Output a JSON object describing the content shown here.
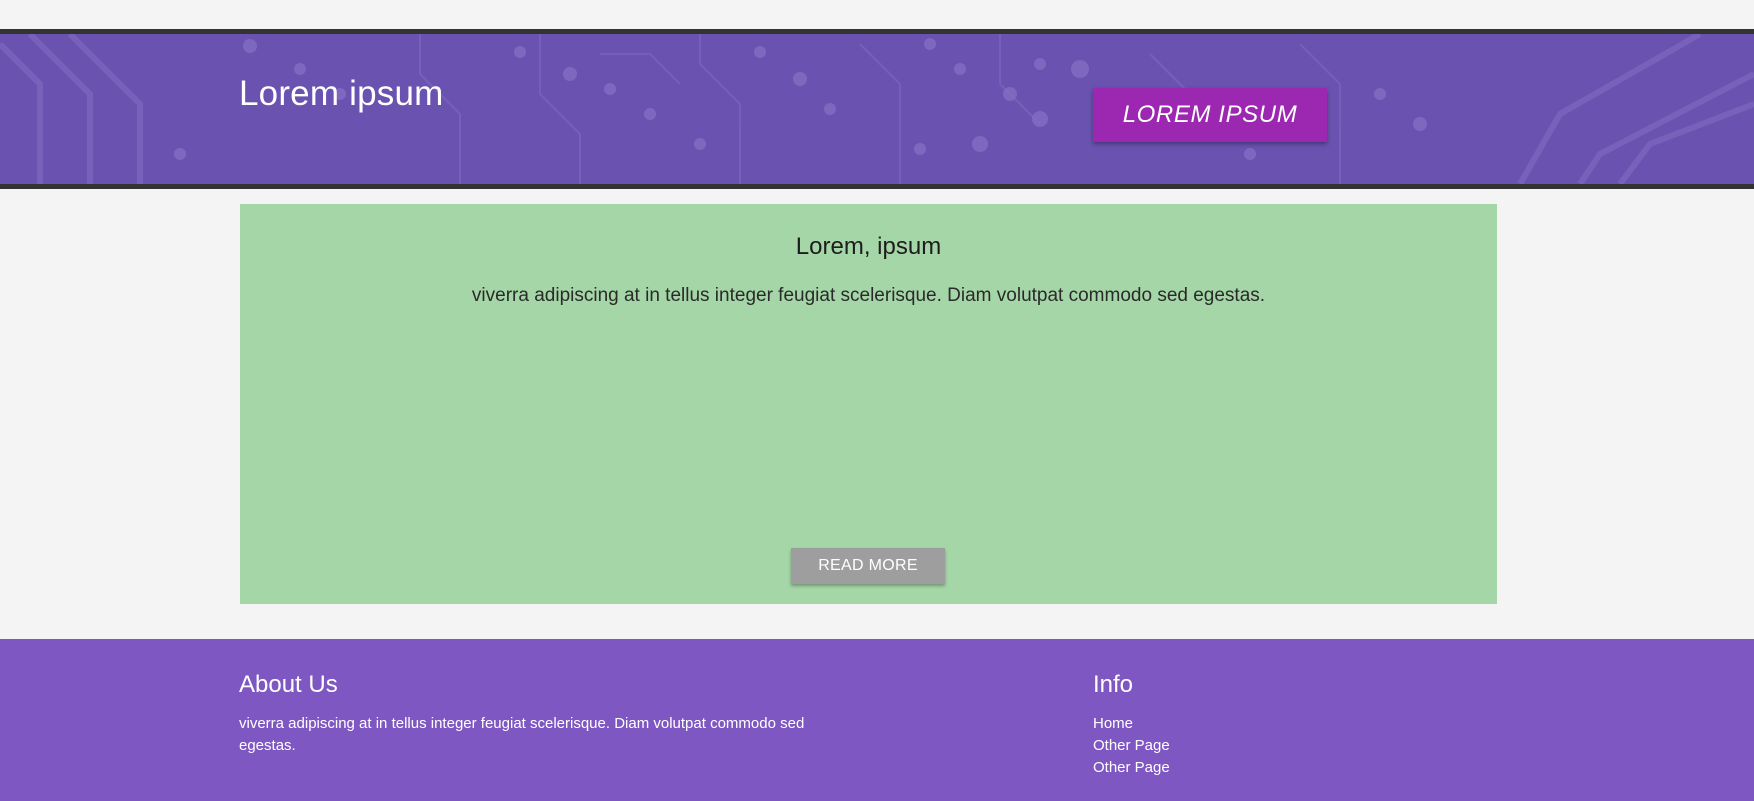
{
  "header": {
    "title": "Lorem ipsum",
    "button_label": "LOREM IPSUM"
  },
  "card": {
    "title": "Lorem, ipsum",
    "text": "viverra adipiscing at in tellus integer feugiat scelerisque. Diam volutpat commodo sed egestas.",
    "button_label": "READ MORE"
  },
  "footer": {
    "about": {
      "heading": "About Us",
      "text": "viverra adipiscing at in tellus integer feugiat scelerisque. Diam volutpat commodo sed egestas."
    },
    "info": {
      "heading": "Info",
      "links": [
        {
          "label": "Home"
        },
        {
          "label": "Other Page"
        },
        {
          "label": "Other Page"
        }
      ]
    }
  },
  "colors": {
    "header_bg": "#6a52b0",
    "header_border": "#333333",
    "header_button": "#9c27b0",
    "card_bg": "#a5d6a7",
    "read_more_button": "#9e9e9e",
    "footer_bg": "#7e57c2",
    "page_bg": "#f4f4f4"
  }
}
